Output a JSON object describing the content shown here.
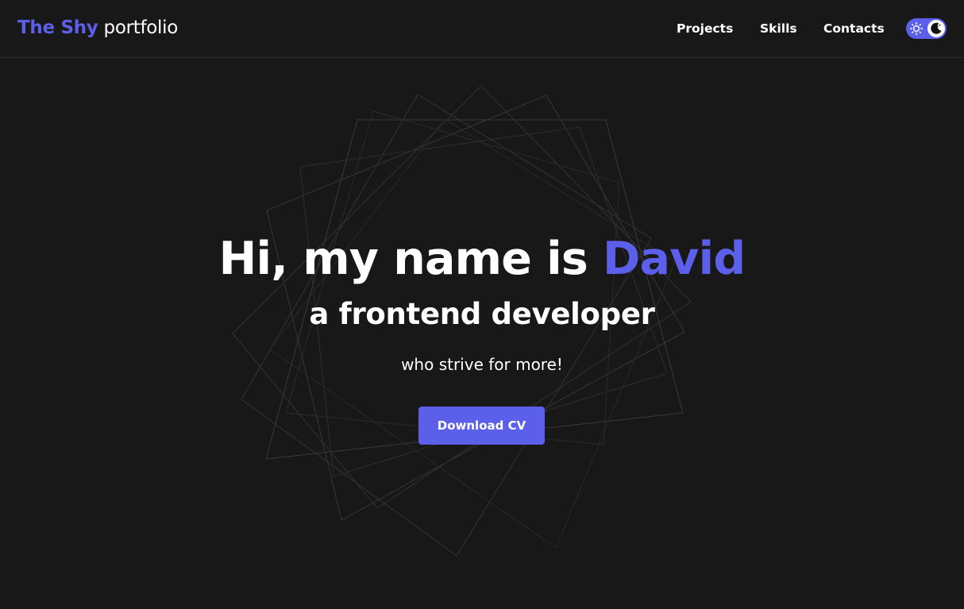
{
  "header": {
    "logo_accent": "The Shy",
    "logo_rest": "portfolio",
    "nav": {
      "projects": "Projects",
      "skills": "Skills",
      "contacts": "Contacts"
    },
    "theme_toggle": {
      "left_icon": "sun-icon",
      "right_icon": "moon-icon",
      "active_theme": "dark"
    }
  },
  "hero": {
    "title_prefix": "Hi, my name is",
    "name": "David",
    "subtitle": "a frontend developer",
    "tagline": "who strive for more!",
    "cta_label": "Download CV"
  },
  "colors": {
    "background": "#181818",
    "accent": "#5b5fe9",
    "text": "#ffffff",
    "divider": "#2d2d2d"
  }
}
